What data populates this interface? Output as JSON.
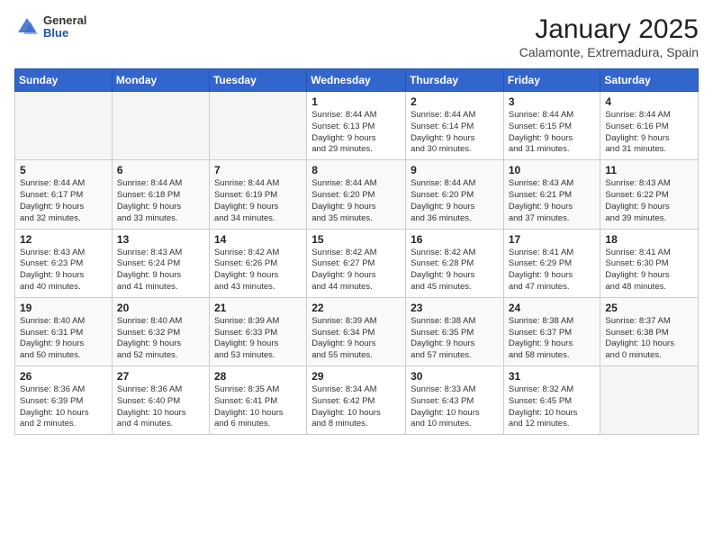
{
  "header": {
    "logo_general": "General",
    "logo_blue": "Blue",
    "title": "January 2025",
    "location": "Calamonte, Extremadura, Spain"
  },
  "weekdays": [
    "Sunday",
    "Monday",
    "Tuesday",
    "Wednesday",
    "Thursday",
    "Friday",
    "Saturday"
  ],
  "weeks": [
    [
      {
        "day": "",
        "info": ""
      },
      {
        "day": "",
        "info": ""
      },
      {
        "day": "",
        "info": ""
      },
      {
        "day": "1",
        "info": "Sunrise: 8:44 AM\nSunset: 6:13 PM\nDaylight: 9 hours\nand 29 minutes."
      },
      {
        "day": "2",
        "info": "Sunrise: 8:44 AM\nSunset: 6:14 PM\nDaylight: 9 hours\nand 30 minutes."
      },
      {
        "day": "3",
        "info": "Sunrise: 8:44 AM\nSunset: 6:15 PM\nDaylight: 9 hours\nand 31 minutes."
      },
      {
        "day": "4",
        "info": "Sunrise: 8:44 AM\nSunset: 6:16 PM\nDaylight: 9 hours\nand 31 minutes."
      }
    ],
    [
      {
        "day": "5",
        "info": "Sunrise: 8:44 AM\nSunset: 6:17 PM\nDaylight: 9 hours\nand 32 minutes."
      },
      {
        "day": "6",
        "info": "Sunrise: 8:44 AM\nSunset: 6:18 PM\nDaylight: 9 hours\nand 33 minutes."
      },
      {
        "day": "7",
        "info": "Sunrise: 8:44 AM\nSunset: 6:19 PM\nDaylight: 9 hours\nand 34 minutes."
      },
      {
        "day": "8",
        "info": "Sunrise: 8:44 AM\nSunset: 6:20 PM\nDaylight: 9 hours\nand 35 minutes."
      },
      {
        "day": "9",
        "info": "Sunrise: 8:44 AM\nSunset: 6:20 PM\nDaylight: 9 hours\nand 36 minutes."
      },
      {
        "day": "10",
        "info": "Sunrise: 8:43 AM\nSunset: 6:21 PM\nDaylight: 9 hours\nand 37 minutes."
      },
      {
        "day": "11",
        "info": "Sunrise: 8:43 AM\nSunset: 6:22 PM\nDaylight: 9 hours\nand 39 minutes."
      }
    ],
    [
      {
        "day": "12",
        "info": "Sunrise: 8:43 AM\nSunset: 6:23 PM\nDaylight: 9 hours\nand 40 minutes."
      },
      {
        "day": "13",
        "info": "Sunrise: 8:43 AM\nSunset: 6:24 PM\nDaylight: 9 hours\nand 41 minutes."
      },
      {
        "day": "14",
        "info": "Sunrise: 8:42 AM\nSunset: 6:26 PM\nDaylight: 9 hours\nand 43 minutes."
      },
      {
        "day": "15",
        "info": "Sunrise: 8:42 AM\nSunset: 6:27 PM\nDaylight: 9 hours\nand 44 minutes."
      },
      {
        "day": "16",
        "info": "Sunrise: 8:42 AM\nSunset: 6:28 PM\nDaylight: 9 hours\nand 45 minutes."
      },
      {
        "day": "17",
        "info": "Sunrise: 8:41 AM\nSunset: 6:29 PM\nDaylight: 9 hours\nand 47 minutes."
      },
      {
        "day": "18",
        "info": "Sunrise: 8:41 AM\nSunset: 6:30 PM\nDaylight: 9 hours\nand 48 minutes."
      }
    ],
    [
      {
        "day": "19",
        "info": "Sunrise: 8:40 AM\nSunset: 6:31 PM\nDaylight: 9 hours\nand 50 minutes."
      },
      {
        "day": "20",
        "info": "Sunrise: 8:40 AM\nSunset: 6:32 PM\nDaylight: 9 hours\nand 52 minutes."
      },
      {
        "day": "21",
        "info": "Sunrise: 8:39 AM\nSunset: 6:33 PM\nDaylight: 9 hours\nand 53 minutes."
      },
      {
        "day": "22",
        "info": "Sunrise: 8:39 AM\nSunset: 6:34 PM\nDaylight: 9 hours\nand 55 minutes."
      },
      {
        "day": "23",
        "info": "Sunrise: 8:38 AM\nSunset: 6:35 PM\nDaylight: 9 hours\nand 57 minutes."
      },
      {
        "day": "24",
        "info": "Sunrise: 8:38 AM\nSunset: 6:37 PM\nDaylight: 9 hours\nand 58 minutes."
      },
      {
        "day": "25",
        "info": "Sunrise: 8:37 AM\nSunset: 6:38 PM\nDaylight: 10 hours\nand 0 minutes."
      }
    ],
    [
      {
        "day": "26",
        "info": "Sunrise: 8:36 AM\nSunset: 6:39 PM\nDaylight: 10 hours\nand 2 minutes."
      },
      {
        "day": "27",
        "info": "Sunrise: 8:36 AM\nSunset: 6:40 PM\nDaylight: 10 hours\nand 4 minutes."
      },
      {
        "day": "28",
        "info": "Sunrise: 8:35 AM\nSunset: 6:41 PM\nDaylight: 10 hours\nand 6 minutes."
      },
      {
        "day": "29",
        "info": "Sunrise: 8:34 AM\nSunset: 6:42 PM\nDaylight: 10 hours\nand 8 minutes."
      },
      {
        "day": "30",
        "info": "Sunrise: 8:33 AM\nSunset: 6:43 PM\nDaylight: 10 hours\nand 10 minutes."
      },
      {
        "day": "31",
        "info": "Sunrise: 8:32 AM\nSunset: 6:45 PM\nDaylight: 10 hours\nand 12 minutes."
      },
      {
        "day": "",
        "info": ""
      }
    ]
  ]
}
